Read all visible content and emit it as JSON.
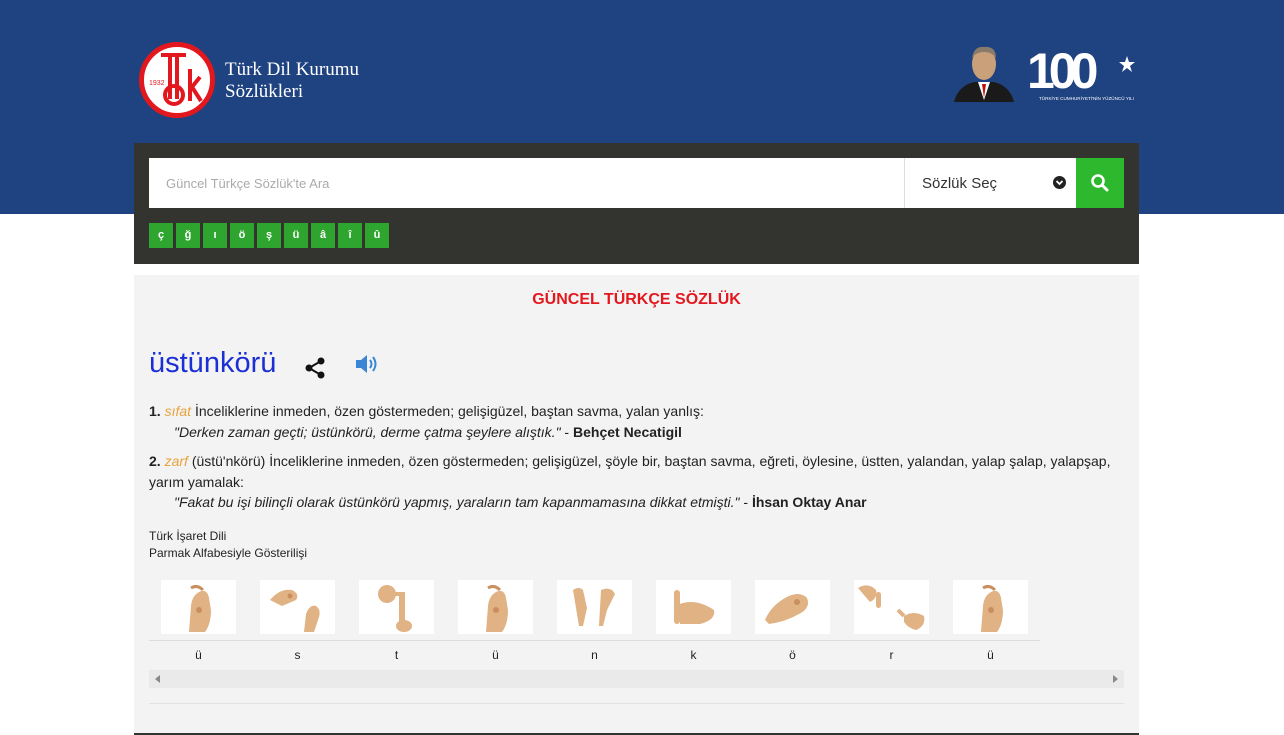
{
  "brand": {
    "name_line1": "Türk Dil Kurumu",
    "name_line2": "Sözlükleri",
    "logo_year": "1932",
    "logo_letters": "tdk",
    "accent_color": "#e3181f",
    "header_color": "#1f4280"
  },
  "centennial": {
    "number": "100",
    "caption": "TÜRKİYE CUMHURİYETİ'NİN YÜZÜNCÜ YILI"
  },
  "search": {
    "placeholder": "Güncel Türkçe Sözlük'te Ara",
    "value": "",
    "select_label": "Sözlük Seç",
    "button_icon": "search-icon",
    "button_color": "#2eb82e"
  },
  "special_chars": [
    "ç",
    "ğ",
    "ı",
    "ö",
    "ş",
    "ü",
    "â",
    "î",
    "û"
  ],
  "result": {
    "dictionary_title": "GÜNCEL TÜRKÇE SÖZLÜK",
    "word": "üstünkörü",
    "share_icon": "share-icon",
    "audio_icon": "speaker-icon",
    "definitions": [
      {
        "number": "1.",
        "type": "sıfat",
        "pron": "",
        "text": "İnceliklerine inmeden, özen göstermeden; gelişigüzel, baştan savma, yalan yanlış:",
        "example": "\"Derken zaman geçti; üstünkörü, derme çatma şeylere alıştık.\"",
        "example_sep": " - ",
        "author": "Behçet Necatigil"
      },
      {
        "number": "2.",
        "type": "zarf",
        "pron": "(üstü'nkörü)",
        "text": "İnceliklerine inmeden, özen göstermeden; gelişigüzel, şöyle bir, baştan savma, eğreti, öylesine, üstten, yalandan, yalap şalap, yalapşap, yarım yamalak:",
        "example": "\"Fakat bu işi bilinçli olarak üstünkörü yapmış, yaraların tam kapanmamasına dikkat etmişti.\"",
        "example_sep": " - ",
        "author": "İhsan Oktay Anar"
      }
    ]
  },
  "sign_language": {
    "title": "Türk İşaret Dili",
    "subtitle": "Parmak Alfabesiyle Gösterilişi",
    "letters": [
      "ü",
      "s",
      "t",
      "ü",
      "n",
      "k",
      "ö",
      "r",
      "ü"
    ]
  }
}
